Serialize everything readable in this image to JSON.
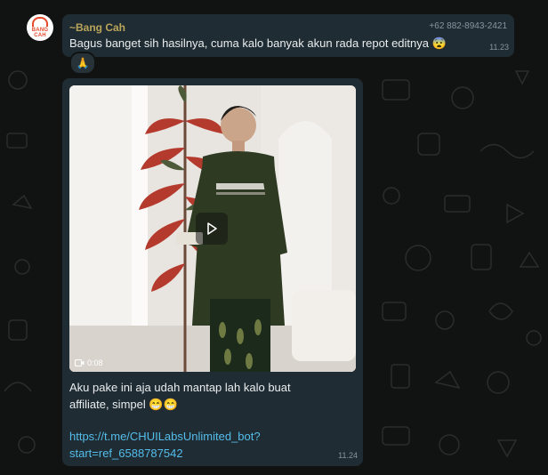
{
  "message1": {
    "sender": "~Bang Cah",
    "phone": "+62 882-8943-2421",
    "text": "Bagus banget sih hasilnya, cuma kalo banyak akun rada repot editnya",
    "text_emoji": "😨",
    "time": "11.23",
    "reaction": "🙏"
  },
  "avatar": {
    "label_line1": "BANG",
    "label_line2": "CAH"
  },
  "message2": {
    "video_duration": "0:08",
    "caption_line1": "Aku pake ini aja udah mantap lah kalo buat",
    "caption_line2": "affiliate, simpel",
    "caption_emoji": "😁😁",
    "link_line1": "https://t.me/CHUILabsUnlimited_bot?",
    "link_line2": "start=ref_6588787542",
    "time": "11.24"
  },
  "colors": {
    "background": "#111312",
    "bubble": "#202c33",
    "sender": "#b9a55a",
    "link": "#53bdeb",
    "text": "#e9edef",
    "meta": "#8696a0"
  }
}
